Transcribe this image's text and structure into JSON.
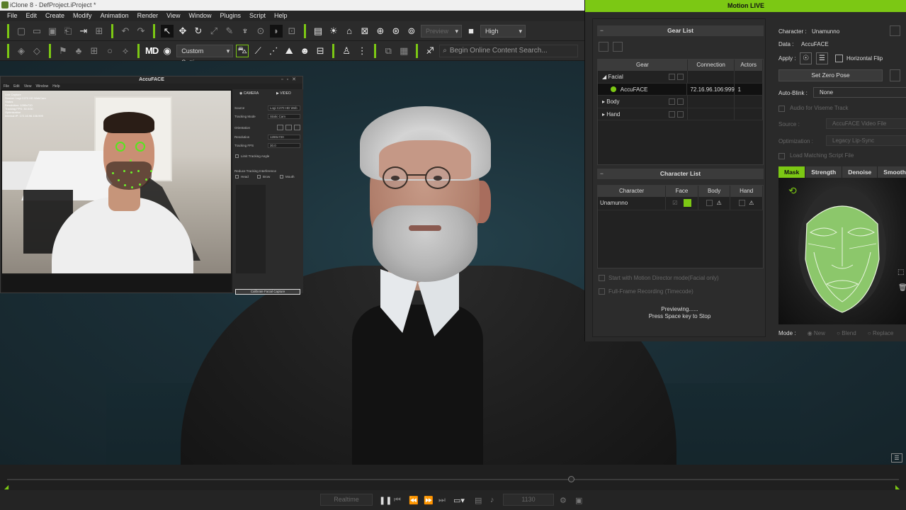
{
  "window": {
    "title": "iClone 8 - DefProject.iProject *"
  },
  "menu": [
    "File",
    "Edit",
    "Create",
    "Modify",
    "Animation",
    "Render",
    "View",
    "Window",
    "Plugins",
    "Script",
    "Help"
  ],
  "toolbar": {
    "preview_label": "Preview",
    "quality_label": "High",
    "custom_settings_label": "Custom Settings",
    "search_placeholder": "Begin Online Content Search..."
  },
  "accuface": {
    "title": "AccuFACE",
    "menu": [
      "File",
      "Edit",
      "View",
      "Window",
      "Help"
    ],
    "hud": "Live Capture\nSource: Logi C270 HD WebCam\nStatus\nResolution: 1280x720\nTracking FPS: 30.0/30\nOptimization\nInternal IP: 172.16.96.106:999",
    "tabs": {
      "camera": "CAMERA",
      "video": "VIDEO"
    },
    "rows": {
      "source_label": "Source",
      "source_value": "Logi C270 HD Web",
      "tracking_mode_label": "Tracking Mode",
      "tracking_mode_value": "Static Cam",
      "orientation_label": "Orientation",
      "resolution_label": "Resolution",
      "resolution_value": "1280x720",
      "tracking_fps_label": "Tracking FPS",
      "tracking_fps_value": "30.0",
      "limit_angle_label": "Limit Tracking Angle",
      "interference_label": "Reduce Tracking Interference",
      "head_label": "Head",
      "brow_label": "Brow",
      "mouth_label": "Mouth"
    },
    "calibrate_label": "Calibrate Facial Capture"
  },
  "motion_live": {
    "title": "Motion LIVE",
    "gear_list": {
      "title": "Gear List",
      "headers": [
        "Gear",
        "Connection",
        "Actors"
      ],
      "rows": [
        {
          "name": "Facial",
          "connection": "",
          "actors": ""
        },
        {
          "name": "AccuFACE",
          "connection": "72.16.96.106:999",
          "actors": "1"
        },
        {
          "name": "Body",
          "connection": "",
          "actors": ""
        },
        {
          "name": "Hand",
          "connection": "",
          "actors": ""
        }
      ]
    },
    "character_list": {
      "title": "Character List",
      "headers": [
        "Character",
        "Face",
        "Body",
        "Hand"
      ],
      "rows": [
        {
          "name": "Unamunno"
        }
      ]
    },
    "options": {
      "motion_director": "Start with Motion Director mode(Facial only)",
      "full_frame": "Full-Frame Recording (Timecode)"
    },
    "preview_line1": "Previewing......",
    "preview_line2": "Press Space key to Stop",
    "right": {
      "character_label": "Character :",
      "character_value": "Unamunno",
      "data_label": "Data :",
      "data_value": "AccuFACE",
      "apply_label": "Apply :",
      "horizontal_flip": "Horizontal Flip",
      "set_zero_pose": "Set Zero Pose",
      "auto_blink_label": "Auto-Blink :",
      "auto_blink_value": "None",
      "audio_viseme": "Audio for Viseme Track",
      "source_label": "Source :",
      "source_value": "AccuFACE Video File",
      "optimization_label": "Optimization :",
      "optimization_value": "Legacy Lip-Sync",
      "load_script": "Load Matching Script File",
      "tabs": [
        "Mask",
        "Strength",
        "Denoise",
        "Smooth"
      ],
      "mode_label": "Mode :",
      "mode_options": [
        "New",
        "Blend",
        "Replace"
      ]
    }
  },
  "playbar": {
    "realtime_label": "Realtime",
    "frame_value": "1130"
  },
  "colors": {
    "accent": "#7cc814",
    "panel": "#2a2a2a",
    "viewport": "#1b2f37"
  }
}
